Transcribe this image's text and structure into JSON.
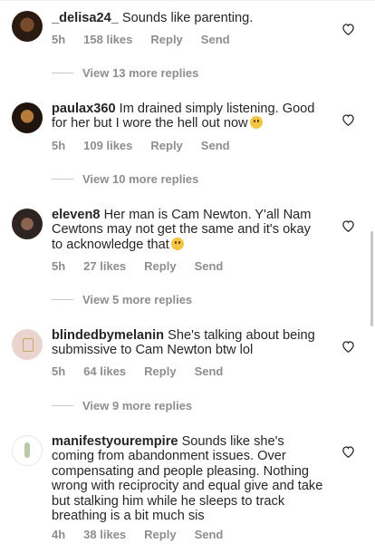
{
  "comments": [
    {
      "username": "_delisa24_",
      "text": "Sounds like parenting.",
      "time": "5h",
      "likes": "158 likes",
      "reply": "Reply",
      "send": "Send",
      "view_replies": "View 13 more replies"
    },
    {
      "username": "paulax360",
      "text": "Im drained simply listening. Good for her but I wore the hell out now",
      "time": "5h",
      "likes": "109 likes",
      "reply": "Reply",
      "send": "Send",
      "view_replies": "View 10 more replies"
    },
    {
      "username": "eleven8",
      "text": "Her man is Cam Newton. Y'all Nam Cewtons may not get the same and it's okay to acknowledge that",
      "time": "5h",
      "likes": "27 likes",
      "reply": "Reply",
      "send": "Send",
      "view_replies": "View 5 more replies"
    },
    {
      "username": "blindedbymelanin",
      "text": "She's talking about being submissive to Cam Newton btw lol",
      "time": "5h",
      "likes": "64 likes",
      "reply": "Reply",
      "send": "Send",
      "view_replies": "View 9 more replies"
    },
    {
      "username": "manifestyourempire",
      "text": "Sounds like she's coming from abandonment issues. Over compensating and people pleasing. Nothing wrong with reciprocity and equal give and take but stalking him while he sleeps to track breathing is a bit much sis",
      "time": "4h",
      "likes": "38 likes",
      "reply": "Reply",
      "send": "Send"
    }
  ],
  "icons": {
    "heart": "heart-outline-icon",
    "emoji_tired": "weary-face-emoji",
    "emoji_laugh": "laughing-face-emoji"
  },
  "colors": {
    "text": "#262626",
    "meta": "#8e8e8e",
    "emoji": "#f4c542"
  }
}
